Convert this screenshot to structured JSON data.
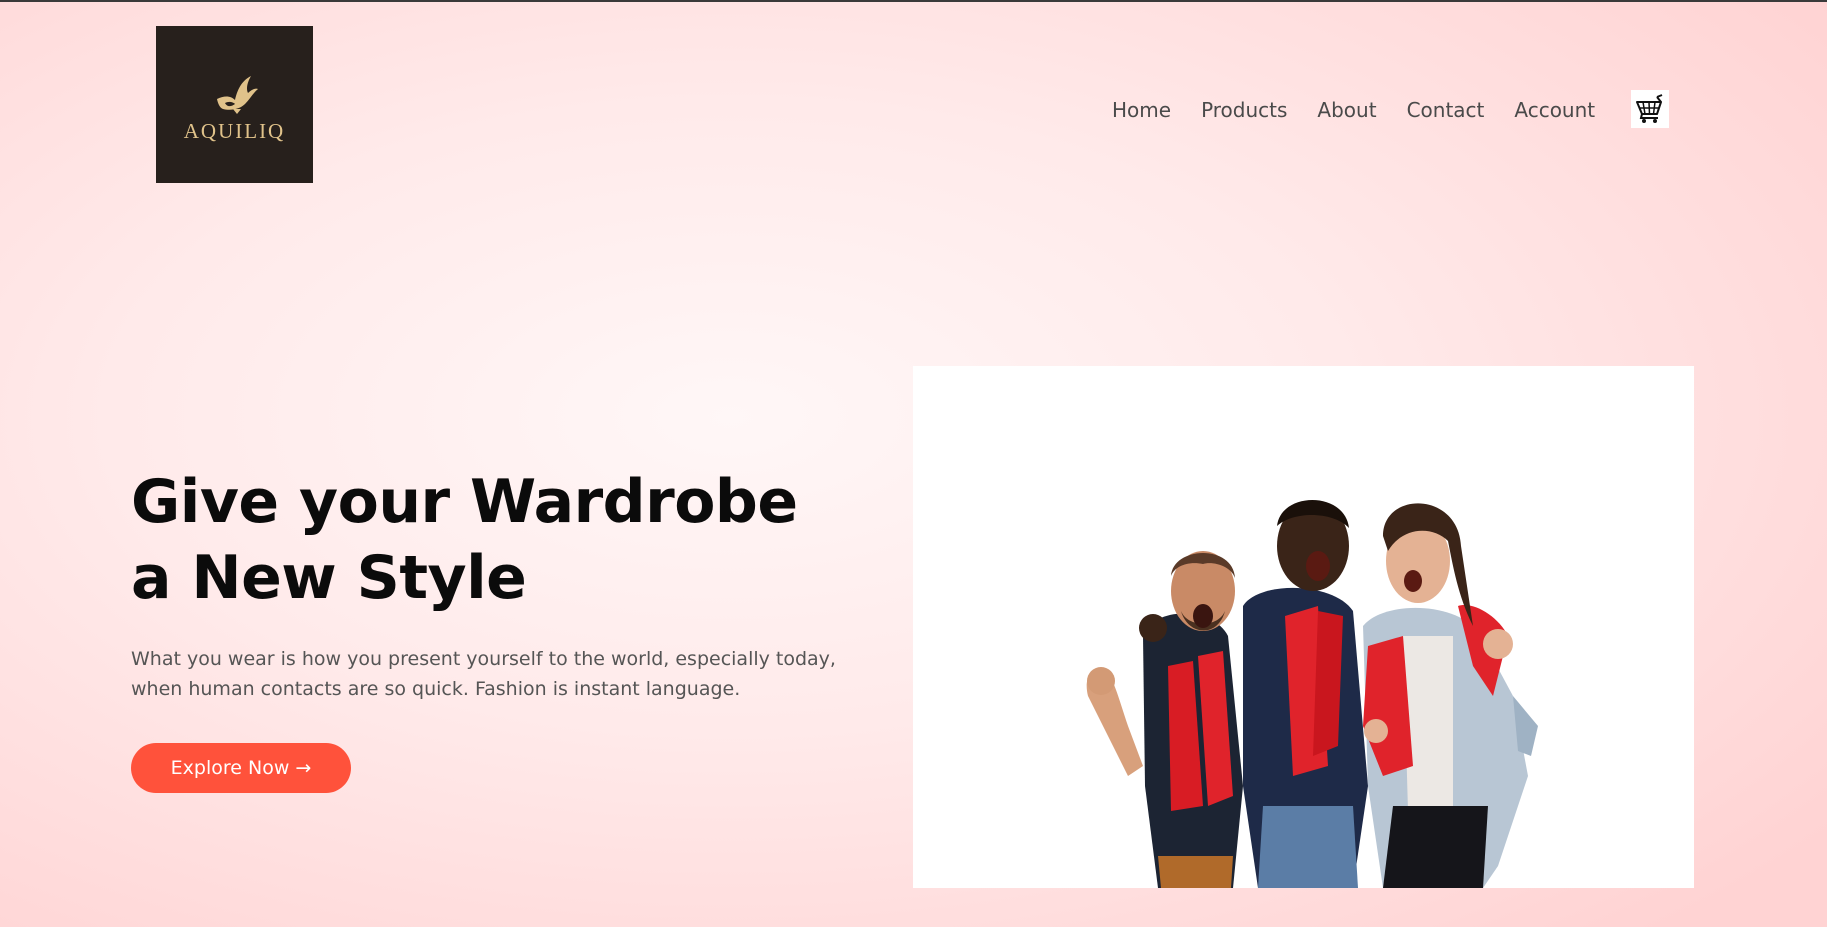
{
  "brand": {
    "name": "AQUILIQ",
    "logo_bg": "#27201c",
    "logo_gold": "#e0c28a",
    "logo_icon": "eagle-icon"
  },
  "nav": {
    "links": [
      "Home",
      "Products",
      "About",
      "Contact",
      "Account"
    ],
    "cart_icon": "shopping-cart-icon"
  },
  "hero": {
    "headline_line1": "Give your Wardrobe",
    "headline_line2": "a New Style",
    "subtext_line1": "What you wear is how you present yourself to the world, especially today,",
    "subtext_line2": "when human contacts are so quick. Fashion is instant language.",
    "cta_label": "Explore Now →",
    "image_alt": "Three cheering fans wearing red scarves"
  },
  "colors": {
    "accent": "#ff523b",
    "background": "#ffe3e3",
    "text_dark": "#0b0b0b",
    "text_muted": "#555555"
  }
}
